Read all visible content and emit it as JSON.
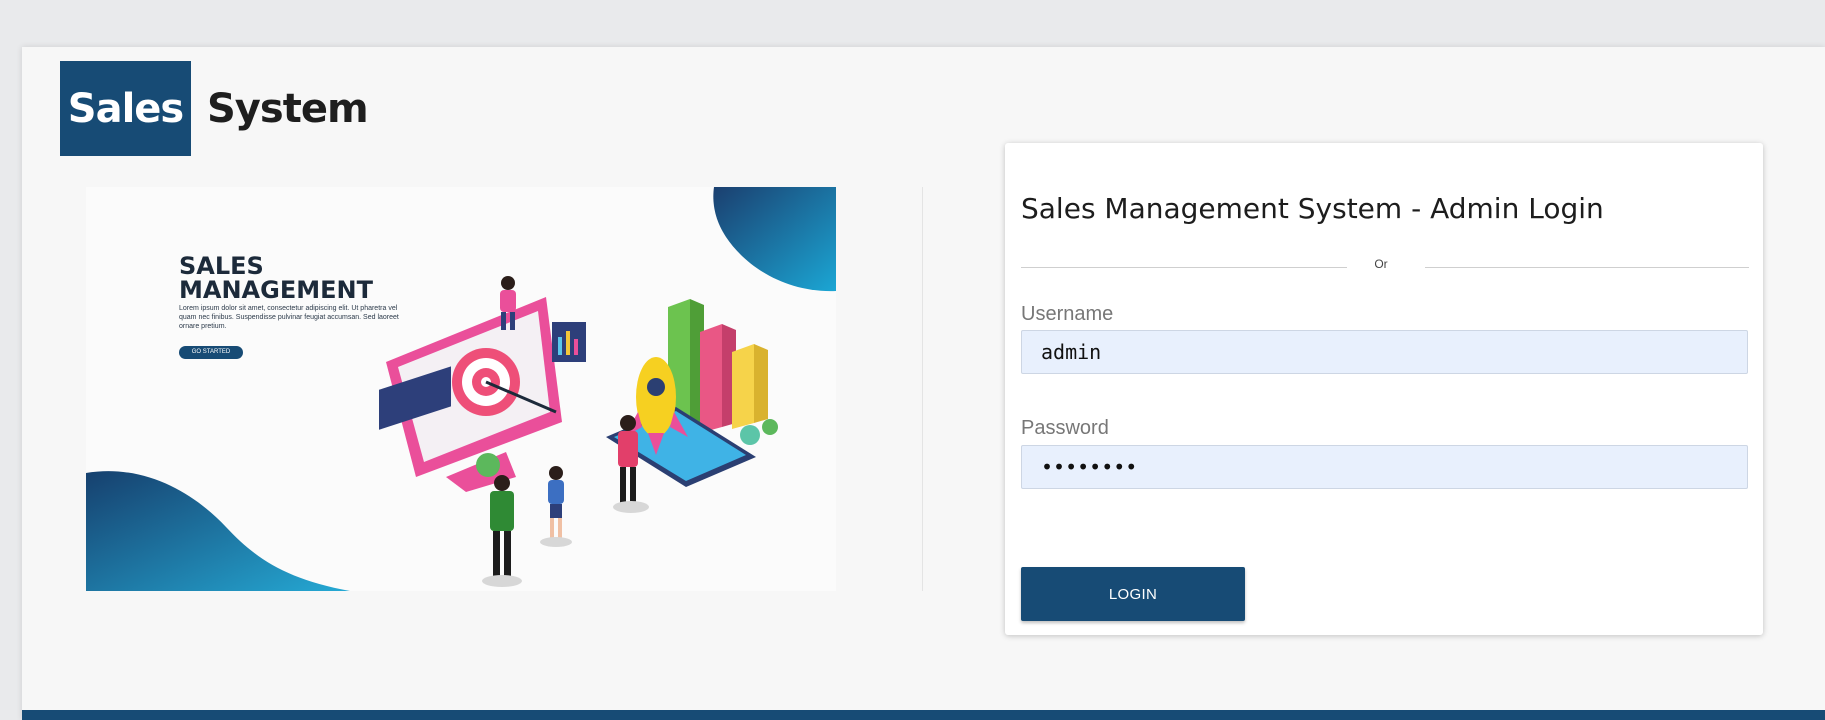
{
  "brand": {
    "box_text": "Sales",
    "text": "System",
    "color": "#174b75"
  },
  "hero": {
    "title": "SALES\nMANAGEMENT",
    "body": "Lorem ipsum dolor sit amet, consectetur adipiscing elit. Ut pharetra vel quam nec finibus. Suspendisse pulvinar feugiat accumsan. Sed laoreet ornare pretium.",
    "button_label": "GO STARTED"
  },
  "login": {
    "title": "Sales Management System - Admin Login",
    "divider_text": "Or",
    "username_label": "Username",
    "username_value": "admin",
    "password_label": "Password",
    "password_value": "passwrd1",
    "submit_label": "LOGIN"
  }
}
